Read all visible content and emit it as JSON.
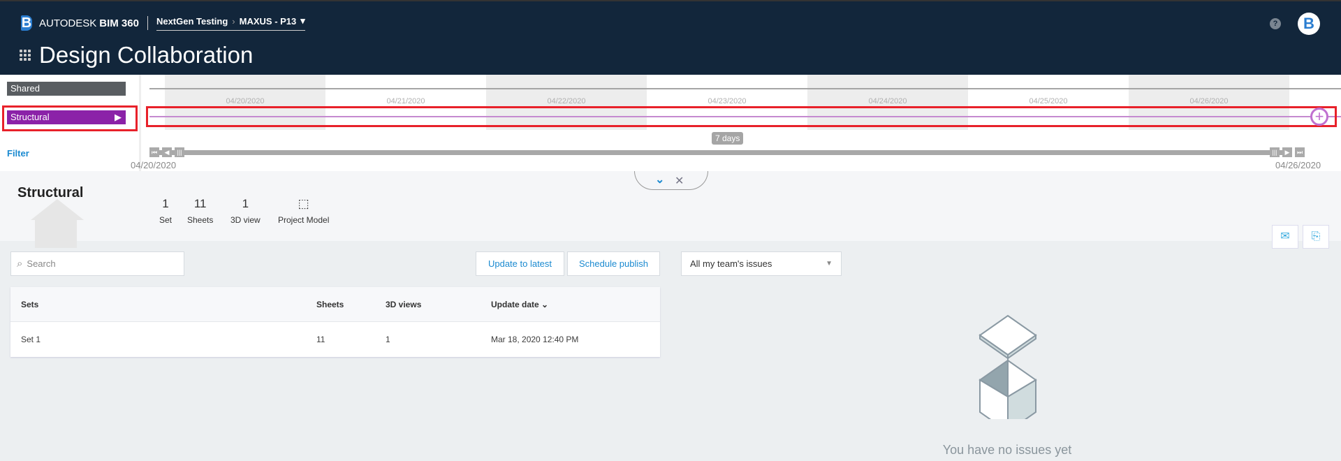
{
  "header": {
    "brand": "AUTODESK",
    "product": "BIM 360",
    "breadcrumb": [
      "NextGen Testing",
      "MAXUS - P13"
    ],
    "app_title": "Design Collaboration",
    "help": "?",
    "avatar": "B"
  },
  "timeline": {
    "packages": [
      {
        "label": "Shared",
        "color": "#595d61"
      },
      {
        "label": "Structural",
        "color": "#8b22a8",
        "active": true
      }
    ],
    "filter": "Filter",
    "dates": [
      "04/20/2020",
      "04/21/2020",
      "04/22/2020",
      "04/23/2020",
      "04/24/2020",
      "04/25/2020",
      "04/26/2020"
    ],
    "range_label": "7 days",
    "range_start": "04/20/2020",
    "range_end": "04/26/2020"
  },
  "summary": {
    "title": "Structural",
    "stats": [
      {
        "n": "1",
        "label": "Set"
      },
      {
        "n": "11",
        "label": "Sheets"
      },
      {
        "n": "1",
        "label": "3D view"
      },
      {
        "n": "",
        "label": "Project Model"
      }
    ]
  },
  "search": {
    "placeholder": "Search"
  },
  "buttons": {
    "update": "Update to latest",
    "schedule": "Schedule publish"
  },
  "table": {
    "columns": [
      "Sets",
      "Sheets",
      "3D views",
      "Update date"
    ],
    "rows": [
      [
        "Set 1",
        "11",
        "1",
        "Mar 18, 2020 12:40 PM"
      ]
    ]
  },
  "issues": {
    "filter": "All my team's issues",
    "empty": "You have no issues yet"
  }
}
